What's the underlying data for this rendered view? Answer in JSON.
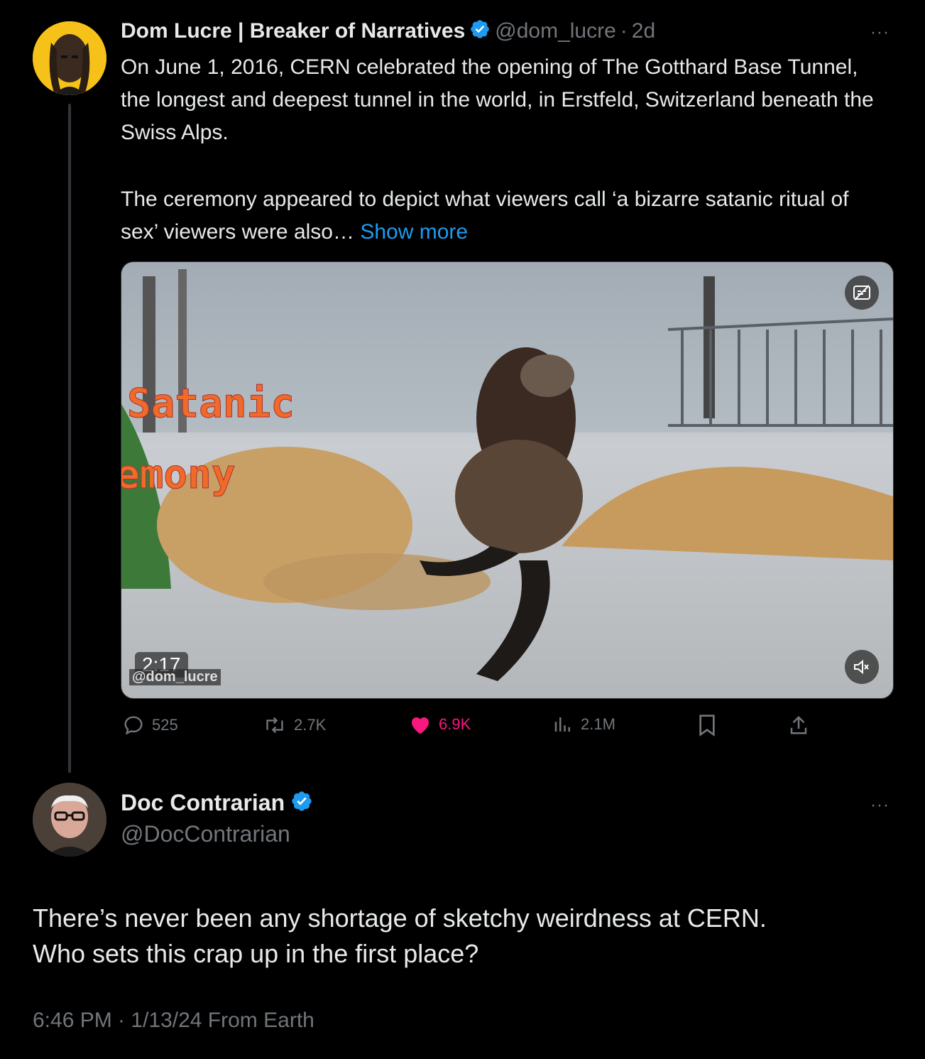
{
  "post": {
    "author_name": "Dom Lucre | Breaker of Narratives",
    "handle": "@dom_lucre",
    "separator": "·",
    "age": "2d",
    "more_label": "···",
    "text_para1": "On June 1, 2016, CERN celebrated the opening of The Gotthard Base Tunnel, the longest and deepest tunnel in the world, in Erstfeld, Switzerland beneath the Swiss Alps.",
    "text_para2": "The ceremony appeared to depict what viewers call ‘a bizarre satanic ritual of sex’ viewers were also…",
    "show_more": "Show more",
    "media": {
      "duration": "2:17",
      "watermark": "@dom_lucre",
      "caption_line1": "Satanic",
      "caption_line2": "emony"
    },
    "actions": {
      "replies": "525",
      "reposts": "2.7K",
      "likes": "6.9K",
      "views": "2.1M"
    }
  },
  "reply": {
    "author_name": "Doc Contrarian",
    "handle": "@DocContrarian",
    "more_label": "···",
    "text_line1": "There’s never been any shortage of sketchy weirdness at CERN.",
    "text_line2": "Who sets this crap up in the first place?",
    "timestamp": "6:46 PM · 1/13/24 From Earth"
  },
  "colors": {
    "background": "#000000",
    "text": "#e7e9ea",
    "muted": "#71767b",
    "accent": "#1d9bf0",
    "like": "#f91880"
  }
}
